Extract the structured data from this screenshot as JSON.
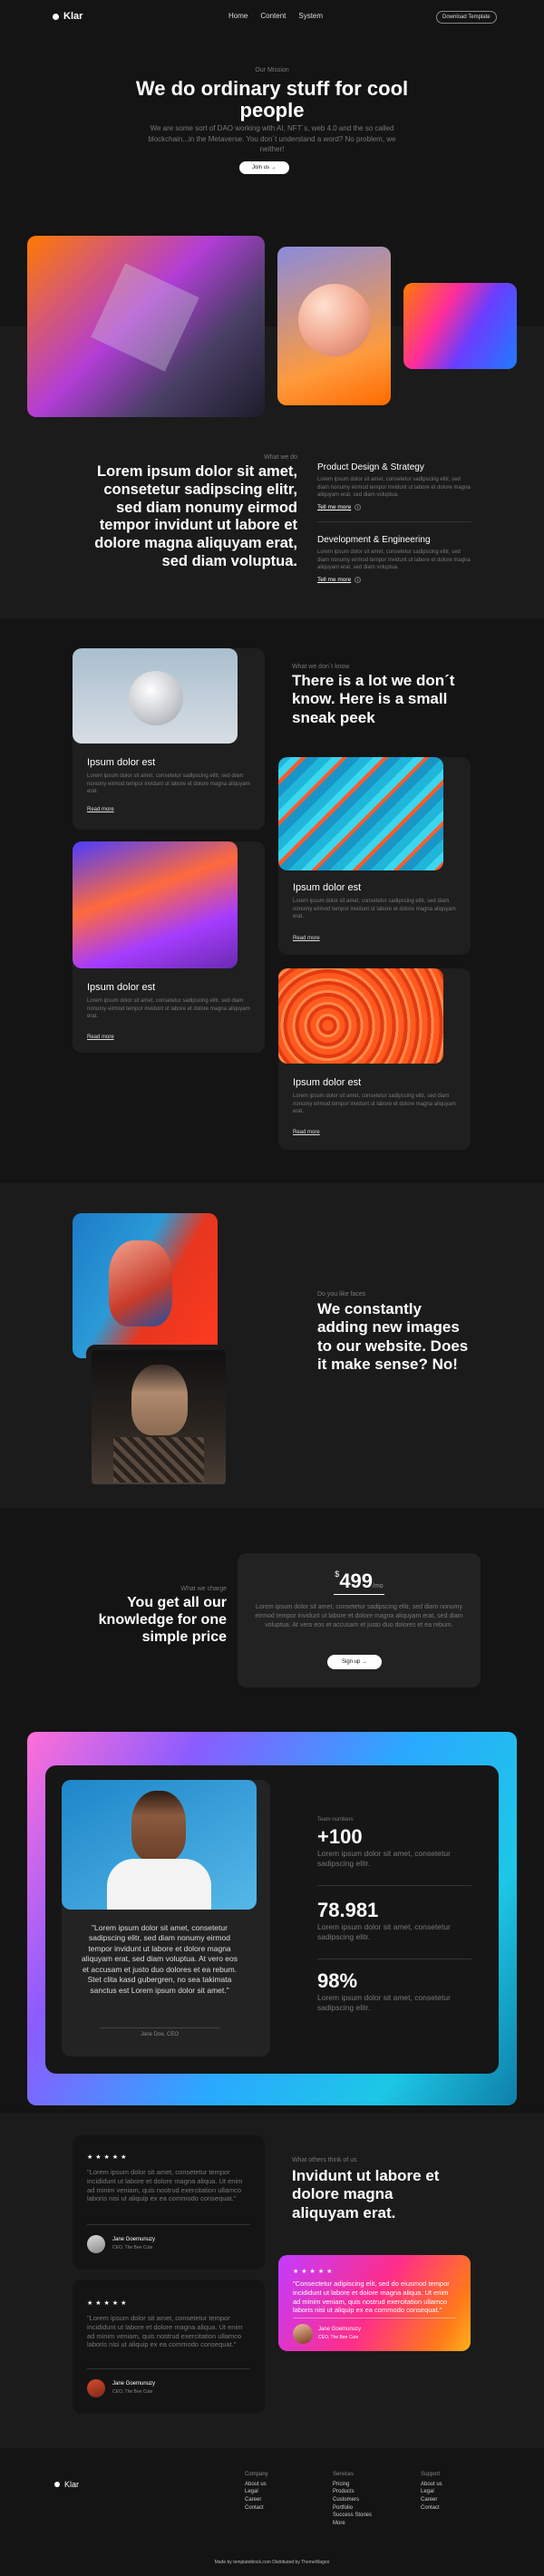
{
  "header": {
    "logo": "Klar",
    "nav": [
      "Home",
      "Content",
      "System"
    ],
    "cta": "Download Template"
  },
  "hero": {
    "eyebrow": "Our Mission",
    "title": "We do ordinary stuff for cool people",
    "subtitle": "We are some sort of DAO working with AI, NFT´s, web 4.0 and the so called blockchain...in the Metaverse. You don´t understand a word? No problem, we neither!",
    "button": "Join us →"
  },
  "what": {
    "eyebrow": "What we do",
    "statement": "Lorem ipsum dolor sit amet, consetetur sadipscing elitr, sed diam nonumy eirmod tempor invidunt ut labore et dolore magna aliquyam erat, sed diam voluptua.",
    "services": [
      {
        "title": "Product Design & Strategy",
        "text": "Lorem ipsum dolor sit amet, consetetur sadipscing elitr, sed diam nonumy eirmod tempor invidunt ut labore et dolore magna aliquyam erat, sed diam voluptua.",
        "link": "Tell me more"
      },
      {
        "title": "Development & Engineering",
        "text": "Lorem ipsum dolor sit amet, consetetur sadipscing elitr, sed diam nonumy eirmod tempor invidunt ut labore et dolore magna aliquyam erat, sed diam voluptua.",
        "link": "Tell me more"
      }
    ]
  },
  "know": {
    "eyebrow": "What we don´t know",
    "title": "There is a lot we don´t know. Here is a small sneak peek",
    "cards": [
      {
        "title": "Ipsum dolor est",
        "text": "Lorem ipsum dolor sit amet, consetetur sadipscing elitr, sed diam nonumy eirmod tempor invidunt ut labore et dolore magna aliquyam erat.",
        "link": "Read more"
      },
      {
        "title": "Ipsum dolor est",
        "text": "Lorem ipsum dolor sit amet, consetetur sadipscing elitr, sed diam nonumy eirmod tempor invidunt ut labore et dolore magna aliquyam erat.",
        "link": "Read more"
      },
      {
        "title": "Ipsum dolor est",
        "text": "Lorem ipsum dolor sit amet, consetetur sadipscing elitr, sed diam nonumy eirmod tempor invidunt ut labore et dolore magna aliquyam erat.",
        "link": "Read more"
      },
      {
        "title": "Ipsum dolor est",
        "text": "Lorem ipsum dolor sit amet, consetetur sadipscing elitr, sed diam nonumy eirmod tempor invidunt ut labore et dolore magna aliquyam erat.",
        "link": "Read more"
      }
    ]
  },
  "images": {
    "eyebrow": "Do you like faces",
    "title": "We constantly adding new images to our website. Does it make sense? No!"
  },
  "pricing": {
    "eyebrow": "What we charge",
    "title": "You get all our knowledge for one simple price",
    "currency": "$",
    "price": "499",
    "period": "/mo",
    "text": "Lorem ipsum dolor sit amet, consetetur sadipscing elitr, sed diam nonumy eirmod tempor invidunt ut labore et dolore magna aliquyam erat, sed diam voluptua. At vero eos et accusam et justo duo dolores et ea rebum.",
    "button": "Sign up →"
  },
  "team": {
    "quote": "\"Lorem ipsum dolor sit amet, consetetur sadipscing elitr, sed diam nonumy eirmod tempor invidunt ut labore et dolore magna aliquyam erat, sed diam voluptua. At vero eos et accusam et justo duo dolores et ea rebum. Stet clita kasd gubergren, no sea takimata sanctus est Lorem ipsum dolor sit amet.\"",
    "person": "Jane Doe, CEO",
    "stats_eyebrow": "Team numbers",
    "stats": [
      {
        "value": "+100",
        "text": "Lorem ipsum dolor sit amet, consetetur sadipscing elitr."
      },
      {
        "value": "78.981",
        "text": "Lorem ipsum dolor sit amet, consetetur sadipscing elitr."
      },
      {
        "value": "98%",
        "text": "Lorem ipsum dolor sit amet, consetetur sadipscing elitr."
      }
    ]
  },
  "testimonials": {
    "eyebrow": "What others think of us",
    "title": "Invidunt ut labore et dolore magna aliquyam erat.",
    "items": [
      {
        "stars": "★★★★★",
        "text": "\"Lorem ipsum dolor sit amet, consetetur tempor incididunt ut labore et dolore magna aliqua. Ut enim ad minim veniam, quis nostrud exercitation ullamco laboris nisi ut aliquip ex ea commodo consequat.\"",
        "name": "Jane Goemunuzy",
        "role": "CEO, The Bee Cute"
      },
      {
        "stars": "★★★★★",
        "text": "\"Lorem ipsum dolor sit amet, consetetur tempor incididunt ut labore et dolore magna aliqua. Ut enim ad minim veniam, quis nostrud exercitation ullamco laboris nisi ut aliquip ex ea commodo consequat.\"",
        "name": "Jane Goemunuzy",
        "role": "CEO, The Bee Cute"
      },
      {
        "stars": "★★★★★",
        "text": "\"Consectetur adipiscing elit, sed do eiusmod tempor incididunt ut labore et dolore magna aliqua. Ut enim ad minim veniam, quis nostrud exercitation ullamco laboris nisi ut aliquip ex ea commodo consequat.\"",
        "name": "Jane Goemunuzy",
        "role": "CEO, The Bee Cute"
      }
    ]
  },
  "footer": {
    "logo": "Klar",
    "columns": [
      {
        "title": "Company",
        "links": [
          "About us",
          "Legal",
          "Career",
          "Contact"
        ]
      },
      {
        "title": "Services",
        "links": [
          "Pricing",
          "Products",
          "Customers",
          "Portfolio",
          "Success Stories",
          "More"
        ]
      },
      {
        "title": "Support",
        "links": [
          "About us",
          "Legal",
          "Career",
          "Contact"
        ]
      }
    ],
    "credit": "Made by templateblock.com Distributed by ThemeWagon"
  },
  "colors": {
    "bg": "#141414",
    "band": "#1b1b1b",
    "card": "#1f1f1f",
    "accent": "#ffffff"
  }
}
